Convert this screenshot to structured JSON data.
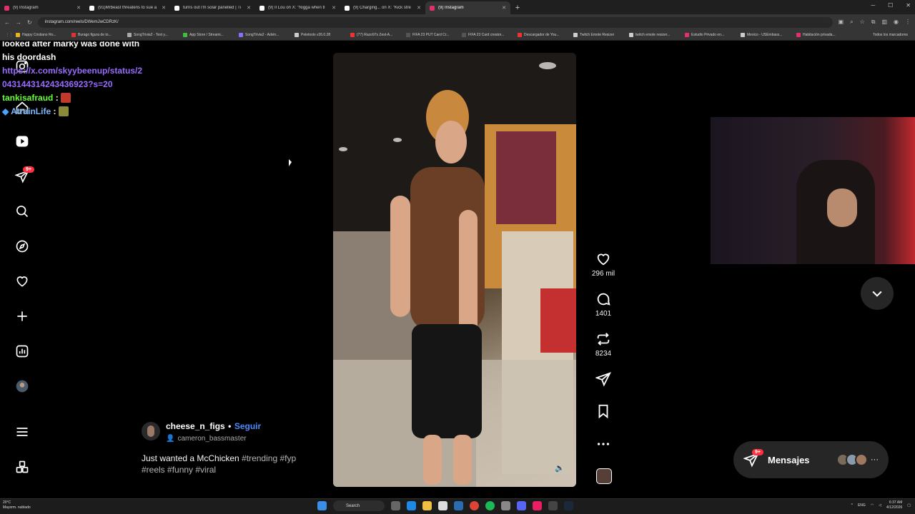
{
  "browser": {
    "tabs": [
      {
        "title": "(9) Instagram",
        "color": "#e1306c"
      },
      {
        "title": "(91)Mrbeast threatens to sue a",
        "color": "#ffffff"
      },
      {
        "title": "turns out i'm solar panelled | Ti",
        "color": "#ffffff"
      },
      {
        "title": "(9) Il Lou on X: \"Nigga when tl",
        "color": "#ffffff"
      },
      {
        "title": "(9) Charging... on X: \"Kick stre",
        "color": "#ffffff"
      },
      {
        "title": "(9) Instagram",
        "color": "#e1306c"
      }
    ],
    "url": "instagram.com/reels/DWemJwCDRzK/",
    "bookmarks": [
      {
        "label": "Happy Cristiano Ro...",
        "color": "#e6b422"
      },
      {
        "label": "Burago figura de to...",
        "color": "#d33"
      },
      {
        "label": "SongTrivia2 - Test y...",
        "color": "#aaa"
      },
      {
        "label": "App Store / Streami...",
        "color": "#3fbf3f"
      },
      {
        "label": "SongTrivia2 - Advin...",
        "color": "#8a6cff"
      },
      {
        "label": "Peletools v26.0.28",
        "color": "#ccc"
      },
      {
        "label": "(77) Razo97s Zest-A...",
        "color": "#e33"
      },
      {
        "label": "FIFA 23 PUT Card Cr...",
        "color": "#555"
      },
      {
        "label": "FIFA 23 Card creator...",
        "color": "#555"
      },
      {
        "label": "Descargador de You...",
        "color": "#e33"
      },
      {
        "label": "Twitch Emote Resizer",
        "color": "#ccc"
      },
      {
        "label": "twitch emote resizer...",
        "color": "#ccc"
      },
      {
        "label": "Estudio Privado en...",
        "color": "#e1306c"
      },
      {
        "label": "Mexico - USEmbass...",
        "color": "#ccc"
      },
      {
        "label": "Habitación privada...",
        "color": "#e1306c"
      }
    ],
    "bookmarks_end": "Todos los marcadores"
  },
  "chat": {
    "line1": "looked after marky was done with",
    "line2": "his doordash",
    "link1": "https://x.com/skyybeenup/status/2",
    "link2": "043144314243436923?s=20",
    "user1": "tankisafraud",
    "user2": "AtrainLife",
    "sep": ":"
  },
  "sidebar": {
    "notif_badge": "9+"
  },
  "reel": {
    "likes": "296 mil",
    "comments": "1401",
    "reposts": "8234",
    "username": "cheese_n_figs",
    "dot": "•",
    "follow": "Seguir",
    "audio": "cameron_bassmaster",
    "caption": "Just wanted a McChicken",
    "tags1": "#trending #fyp",
    "tags2": "#reels #funny #viral"
  },
  "messages": {
    "label": "Mensajes",
    "badge": "9+",
    "more": "···"
  },
  "taskbar": {
    "temp": "20°C",
    "weather": "Mayorm. nublado",
    "search": "Search",
    "lang": "ENG",
    "time": "6:37 AM",
    "date": "4/12/2026"
  }
}
